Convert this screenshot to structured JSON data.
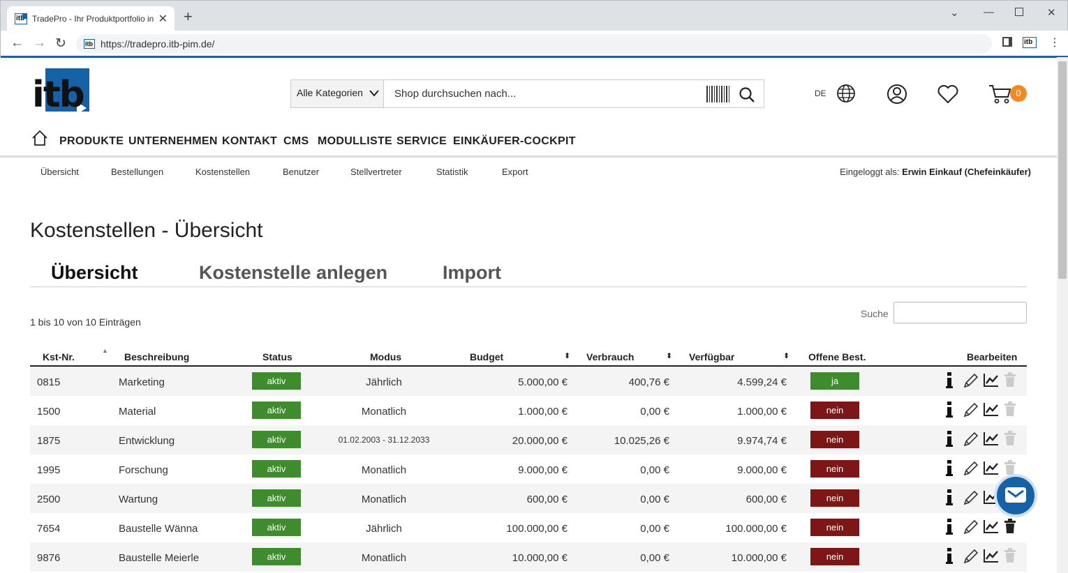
{
  "browser": {
    "tab_title": "TradePro - Ihr Produktportfolio in",
    "favicon_text": "itb",
    "new_tab": "+",
    "url": "https://tradepro.itb-pim.de/"
  },
  "header": {
    "logo_text": "itb",
    "category_select": "Alle Kategorien",
    "search_placeholder": "Shop durchsuchen nach...",
    "language": "DE",
    "cart_count": "0"
  },
  "main_nav": [
    "PRODUKTE",
    "UNTERNEHMEN",
    "KONTAKT",
    "CMS",
    "MODULLISTE",
    "SERVICE",
    "EINKÄUFER-COCKPIT"
  ],
  "sub_nav": [
    "Übersicht",
    "Bestellungen",
    "Kostenstellen",
    "Benutzer",
    "Stellvertreter",
    "Statistik",
    "Export"
  ],
  "logged_in": {
    "label": "Eingeloggt als:",
    "user": "Erwin Einkauf (Chefeinkäufer)"
  },
  "page_title": "Kostenstellen - Übersicht",
  "tabs": [
    "Übersicht",
    "Kostenstelle anlegen",
    "Import"
  ],
  "active_tab": "Übersicht",
  "table_info": "1 bis 10 von 10 Einträgen",
  "search_label": "Suche",
  "columns": [
    "Kst-Nr.",
    "Beschreibung",
    "Status",
    "Modus",
    "Budget",
    "Verbrauch",
    "Verfügbar",
    "Offene Best.",
    "Bearbeiten"
  ],
  "rows": [
    {
      "nr": "0815",
      "desc": "Marketing",
      "status": "aktiv",
      "modus": "Jährlich",
      "budget": "5.000,00 €",
      "verbrauch": "400,76 €",
      "verfuegbar": "4.599,24 €",
      "offen": "ja"
    },
    {
      "nr": "1500",
      "desc": "Material",
      "status": "aktiv",
      "modus": "Monatlich",
      "budget": "1.000,00 €",
      "verbrauch": "0,00 €",
      "verfuegbar": "1.000,00 €",
      "offen": "nein"
    },
    {
      "nr": "1875",
      "desc": "Entwicklung",
      "status": "aktiv",
      "modus": "01.02.2003 - 31.12.2033",
      "budget": "20.000,00 €",
      "verbrauch": "10.025,26 €",
      "verfuegbar": "9.974,74 €",
      "offen": "nein"
    },
    {
      "nr": "1995",
      "desc": "Forschung",
      "status": "aktiv",
      "modus": "Monatlich",
      "budget": "9.000,00 €",
      "verbrauch": "0,00 €",
      "verfuegbar": "9.000,00 €",
      "offen": "nein"
    },
    {
      "nr": "2500",
      "desc": "Wartung",
      "status": "aktiv",
      "modus": "Monatlich",
      "budget": "600,00 €",
      "verbrauch": "0,00 €",
      "verfuegbar": "600,00 €",
      "offen": "nein"
    },
    {
      "nr": "7654",
      "desc": "Baustelle Wänna",
      "status": "aktiv",
      "modus": "Jährlich",
      "budget": "100.000,00 €",
      "verbrauch": "0,00 €",
      "verfuegbar": "100.000,00 €",
      "offen": "nein"
    },
    {
      "nr": "9876",
      "desc": "Baustelle Meierle",
      "status": "aktiv",
      "modus": "Monatlich",
      "budget": "10.000,00 €",
      "verbrauch": "0,00 €",
      "verfuegbar": "10.000,00 €",
      "offen": "nein"
    }
  ],
  "icons": [
    "home-icon",
    "globe-icon",
    "user-icon",
    "heart-icon",
    "cart-icon",
    "search-icon",
    "barcode-icon",
    "info-icon",
    "edit-icon",
    "chart-icon",
    "trash-icon",
    "mail-icon"
  ],
  "colors": {
    "brand": "#1563a6",
    "active": "#3e8c2e",
    "inactive": "#7d1616",
    "cart_badge": "#f28a23"
  }
}
